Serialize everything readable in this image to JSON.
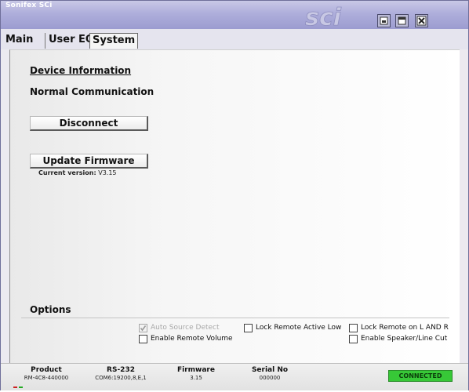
{
  "window": {
    "title": "Sonifex SCi",
    "logo_text": "sci"
  },
  "tabs": [
    {
      "label": "Main",
      "active": false
    },
    {
      "label": "User EQ",
      "active": false
    },
    {
      "label": "System",
      "active": true
    }
  ],
  "system": {
    "device_info_heading": "Device Information",
    "comm_status": "Normal Communication",
    "disconnect_label": "Disconnect",
    "update_firmware_label": "Update Firmware",
    "current_version_label": "Current version:",
    "current_version_value": "V3.15"
  },
  "options": {
    "heading": "Options",
    "checkboxes": [
      {
        "label": "Auto Source Detect",
        "checked": true,
        "enabled": false
      },
      {
        "label": "Enable Remote Volume",
        "checked": false,
        "enabled": true
      },
      {
        "label": "Lock Remote Active Low",
        "checked": false,
        "enabled": true
      },
      {
        "label": "Lock Remote on L AND R",
        "checked": false,
        "enabled": true
      },
      {
        "label": "Enable Speaker/Line Cut",
        "checked": false,
        "enabled": true
      }
    ]
  },
  "status": {
    "product_label": "Product",
    "product_value": "RM-4C8-440000",
    "rs232_label": "RS-232",
    "rs232_value": "COM6:19200,8,E,1",
    "firmware_label": "Firmware",
    "firmware_value": "3.15",
    "serial_label": "Serial No",
    "serial_value": "000000",
    "connection": "CONNECTED"
  },
  "colors": {
    "title_gradient": "#aeaedb",
    "connected": "#37c837",
    "content_bg": "#f6f6f6"
  }
}
